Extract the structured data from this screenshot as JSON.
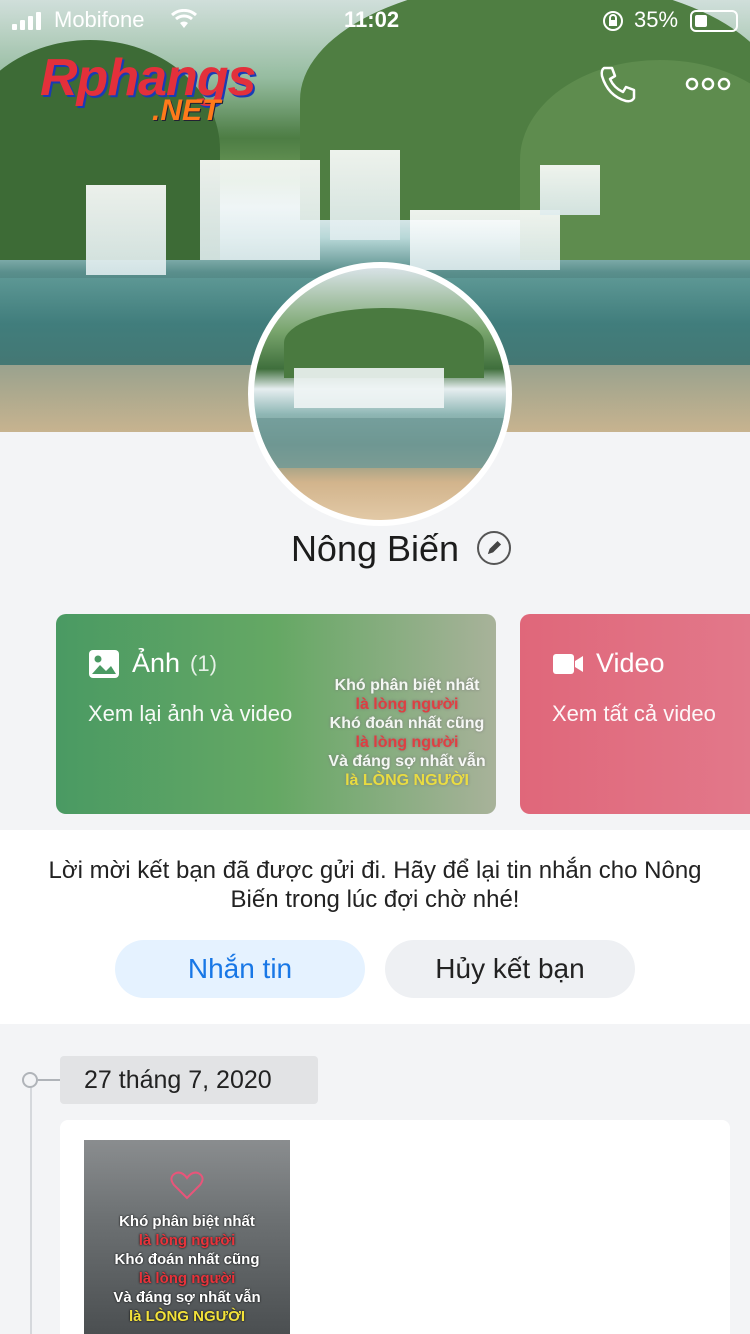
{
  "status_bar": {
    "carrier": "Mobifone",
    "time": "11:02",
    "battery": "35%"
  },
  "watermark": {
    "line1": "Rphangs",
    "line2": ".NET"
  },
  "profile": {
    "name": "Nông Biến"
  },
  "media_cards": {
    "photos": {
      "label": "Ảnh",
      "count": "(1)",
      "subtitle": "Xem lại ảnh và video",
      "icon": "image-icon"
    },
    "videos": {
      "label": "Video",
      "subtitle": "Xem tất cả video",
      "icon": "video-camera-icon"
    }
  },
  "image_text": {
    "l1": "Khó phân biệt nhất",
    "l2": "là lòng người",
    "l3": "Khó đoán nhất cũng",
    "l4": "là lòng người",
    "l5": "Và đáng sợ nhất vẫn",
    "l6": "là LÒNG NGƯỜI"
  },
  "invite": {
    "message": "Lời mời kết bạn đã được gửi đi. Hãy để lại tin nhắn cho Nông Biến trong lúc đợi chờ nhé!",
    "message_button": "Nhắn tin",
    "unfriend_button": "Hủy kết bạn"
  },
  "timeline": {
    "date": "27 tháng 7, 2020"
  },
  "colors": {
    "accent": "#1877e6",
    "photos_card": "#4a9a63",
    "videos_card": "#e0677a"
  }
}
